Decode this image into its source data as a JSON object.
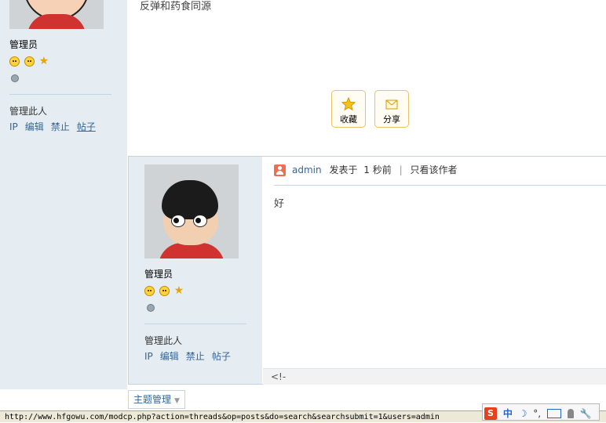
{
  "post1": {
    "user_group": "管理员",
    "body_text": "反弹和药食同源",
    "manage_label": "管理此人",
    "manage_links": [
      "IP",
      "编辑",
      "禁止",
      "帖子"
    ],
    "actions": {
      "favorite": "收藏",
      "share": "分享"
    }
  },
  "post2": {
    "author": "admin",
    "posted_prefix": "发表于",
    "posted_time": "1 秒前",
    "separator": "|",
    "only_author": "只看该作者",
    "body_text": "好",
    "user_group": "管理员",
    "manage_label": "管理此人",
    "manage_links": [
      "IP",
      "编辑",
      "禁止",
      "帖子"
    ],
    "footer_text": "<!-"
  },
  "toolbar": {
    "topic_manage_label": "主题管理"
  },
  "statusbar": {
    "url": "http://www.hfgowu.com/modcp.php?action=threads&op=posts&do=search&searchsubmit=1&users=admin"
  },
  "ime": {
    "logo": "S",
    "mode": "中",
    "punct": "°,"
  },
  "colors": {
    "sidebar_bg": "#e5edf2",
    "link": "#336699",
    "border": "#c2d5e3",
    "button_border": "#e5c26b"
  },
  "icons": [
    "smiley-icon",
    "star-icon",
    "medal-icon",
    "favorite-star-icon",
    "share-envelope-icon",
    "user-icon",
    "dropdown-caret-icon",
    "sogou-ime-icon"
  ]
}
